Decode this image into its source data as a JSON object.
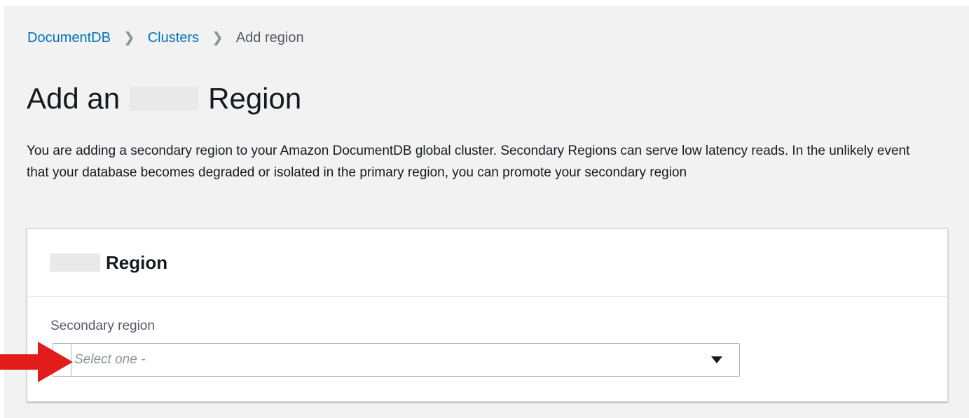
{
  "breadcrumb": {
    "items": [
      "DocumentDB",
      "Clusters"
    ],
    "current": "Add region"
  },
  "page": {
    "title_prefix": "Add an",
    "title_suffix": "Region",
    "description": "You are adding a secondary region to your Amazon DocumentDB global cluster. Secondary Regions can serve low latency reads. In the unlikely event that your database becomes degraded or isolated in the primary region, you can promote your secondary region"
  },
  "panel": {
    "title": "Region",
    "field_label": "Secondary region",
    "select_placeholder": "Select one -"
  },
  "icons": {
    "breadcrumb_separator": "chevron-right-icon",
    "select_caret": "caret-down-icon",
    "annotation": "red-arrow-icon"
  },
  "colors": {
    "link": "#0073bb",
    "annotation_arrow": "#e21b1b",
    "background": "#f2f2f2"
  }
}
